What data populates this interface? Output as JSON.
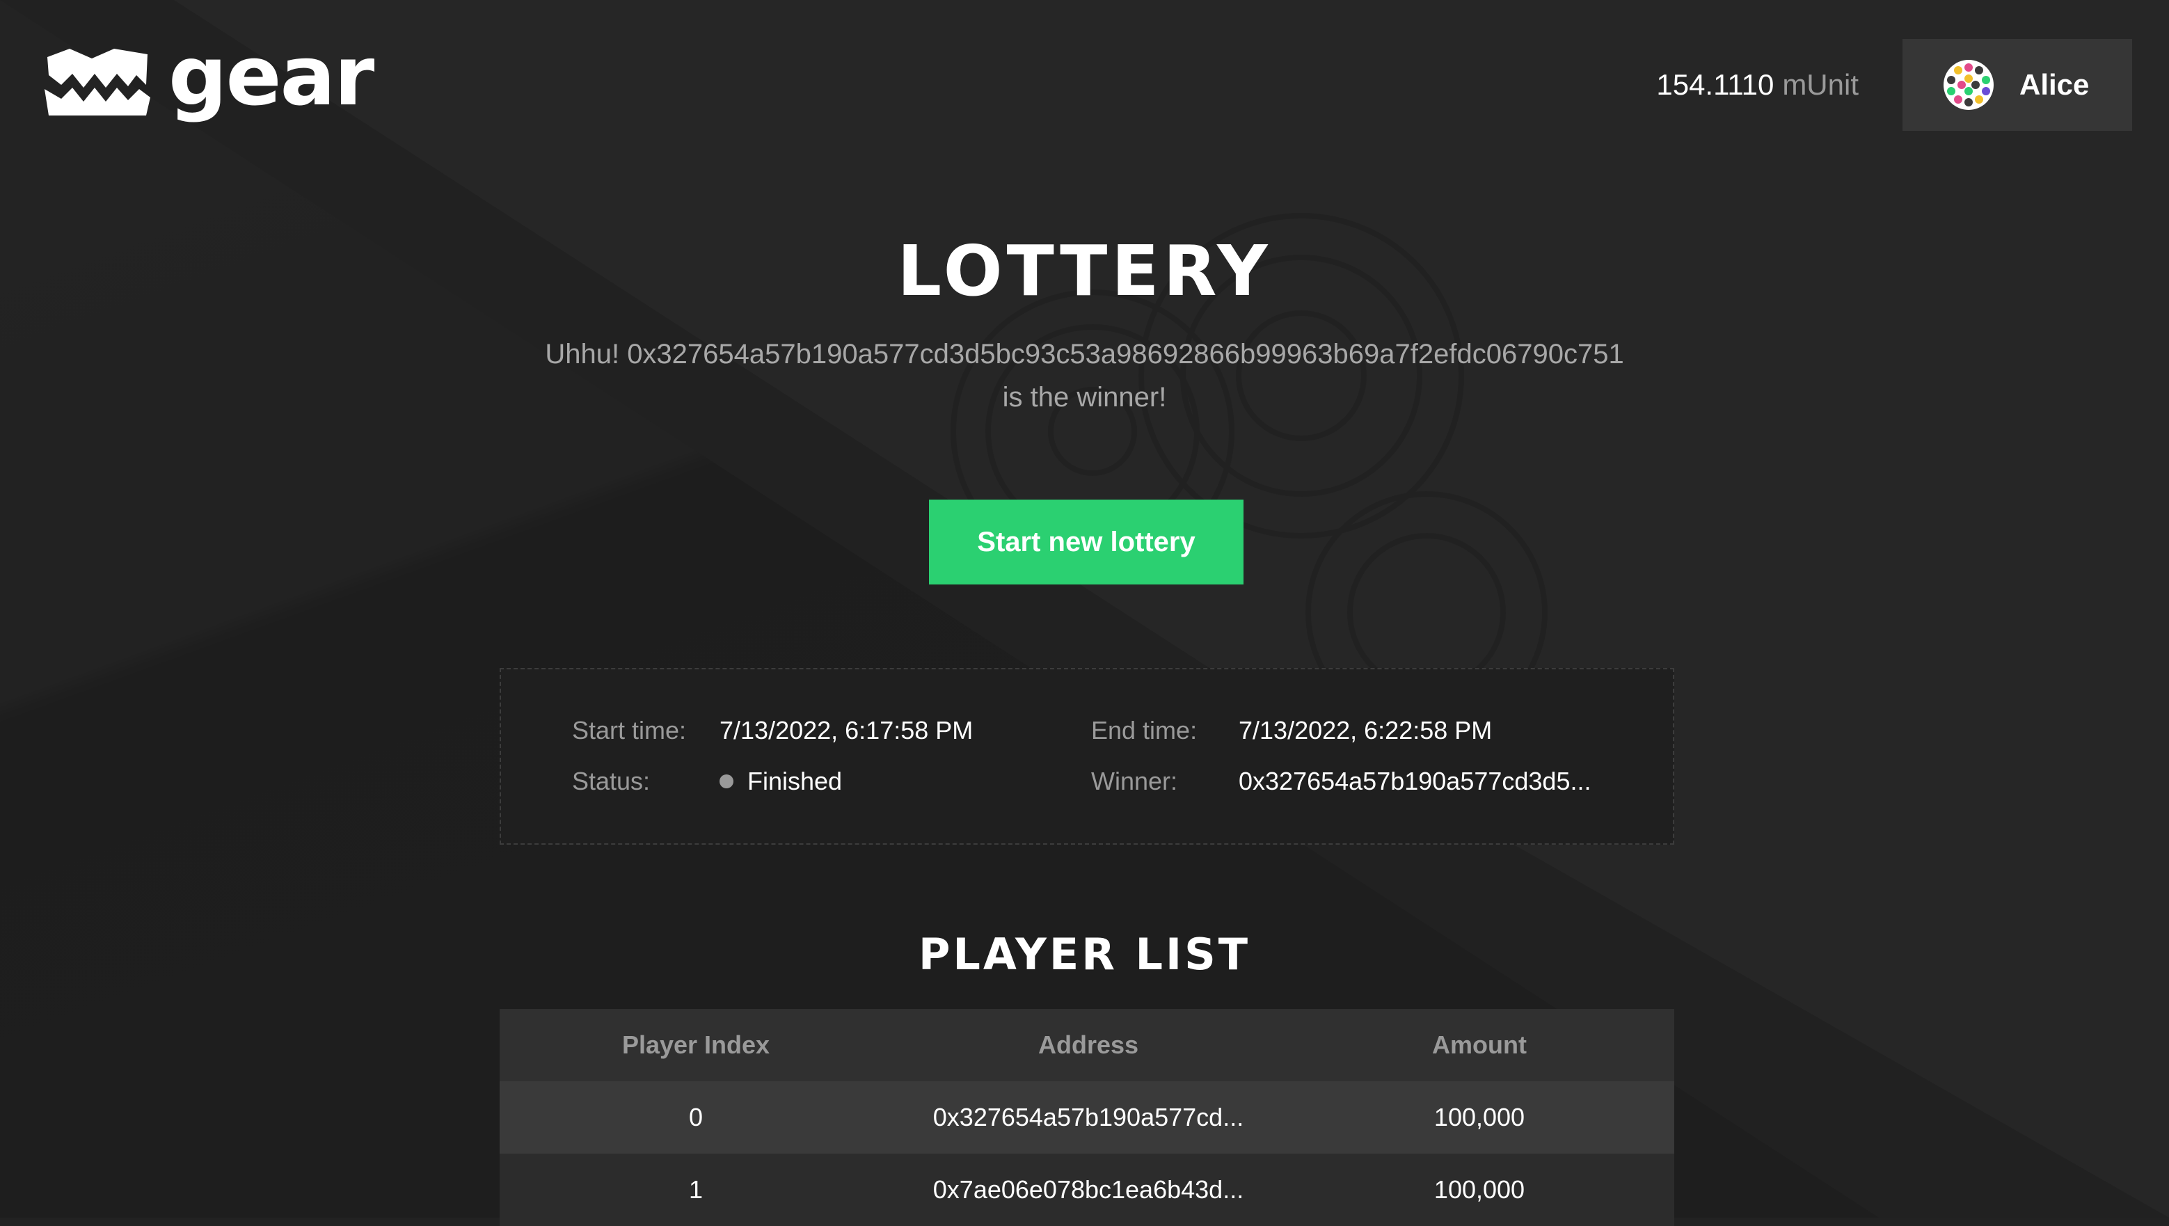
{
  "header": {
    "logo_text": "gear",
    "balance_value": "154.1110",
    "balance_unit": "mUnit",
    "account_name": "Alice"
  },
  "main": {
    "title": "Lottery",
    "winner_prefix": "Uhhu!",
    "winner_address": "0x327654a57b190a577cd3d5bc93c53a98692866b99963b69a7f2efdc06790c751",
    "winner_suffix": "is the winner!",
    "start_button_label": "Start new lottery"
  },
  "info": {
    "start_time_label": "Start time:",
    "start_time_value": "7/13/2022, 6:17:58 PM",
    "end_time_label": "End time:",
    "end_time_value": "7/13/2022, 6:22:58 PM",
    "status_label": "Status:",
    "status_value": "Finished",
    "winner_label": "Winner:",
    "winner_value": "0x327654a57b190a577cd3d5..."
  },
  "players": {
    "title": "Player list",
    "columns": [
      "Player Index",
      "Address",
      "Amount"
    ],
    "rows": [
      {
        "index": "0",
        "address": "0x327654a57b190a577cd...",
        "amount": "100,000"
      },
      {
        "index": "1",
        "address": "0x7ae06e078bc1ea6b43d...",
        "amount": "100,000"
      }
    ]
  },
  "colors": {
    "accent_green": "#2bd071",
    "background": "#222222",
    "muted_text": "#9a9a9a"
  }
}
